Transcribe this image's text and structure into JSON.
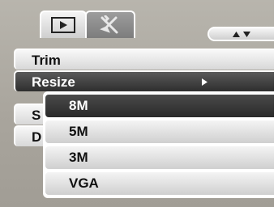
{
  "tabs": [
    {
      "icon": "play-icon",
      "active": true
    },
    {
      "icon": "setup-tools-icon",
      "active": false
    }
  ],
  "scroll": {
    "icons": [
      "up-arrow-icon",
      "down-arrow-icon"
    ]
  },
  "menu": {
    "items": [
      {
        "label": "Trim",
        "selected": false
      },
      {
        "label": "Resize",
        "selected": true,
        "has_submenu": true
      },
      {
        "label": "S",
        "selected": false
      },
      {
        "label": "D",
        "selected": false
      }
    ]
  },
  "submenu": {
    "items": [
      {
        "label": "8M",
        "selected": true
      },
      {
        "label": "5M",
        "selected": false
      },
      {
        "label": "3M",
        "selected": false
      },
      {
        "label": "VGA",
        "selected": false
      }
    ]
  },
  "colors": {
    "background": "#aba79f",
    "row_light": "#e6e6e6",
    "row_selected": "#3c3c3c",
    "text": "#111111",
    "text_selected": "#ffffff"
  }
}
